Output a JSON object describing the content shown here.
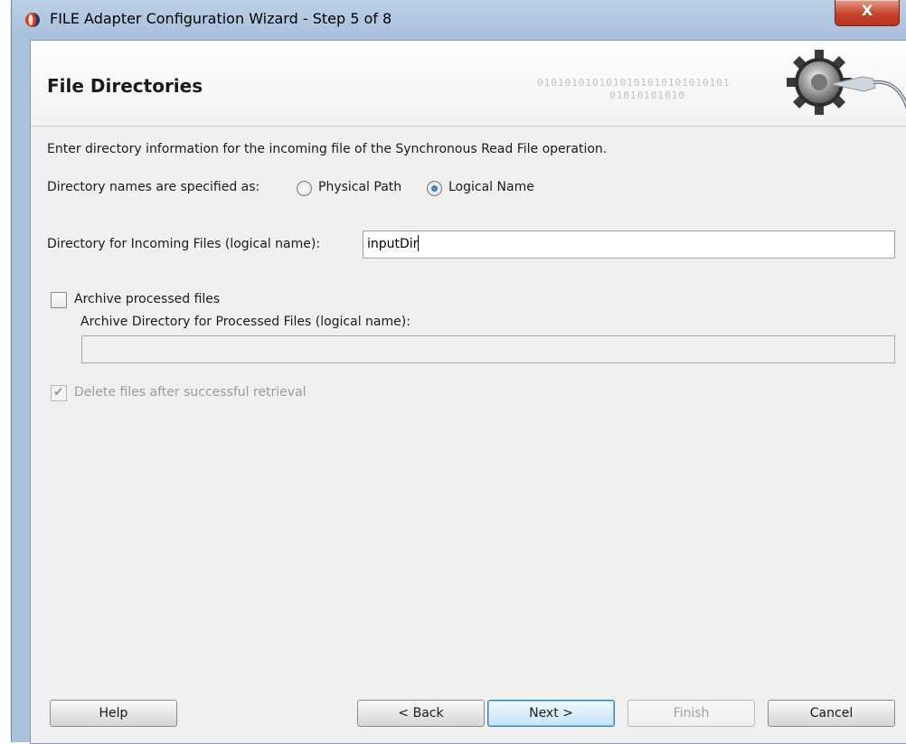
{
  "window": {
    "title": "FILE Adapter Configuration Wizard - Step 5 of 8",
    "close_glyph": "X"
  },
  "header": {
    "title": "File Directories",
    "watermark_line1": "0101010101010101010101010101",
    "watermark_line2": "01010101010"
  },
  "instructions": "Enter directory information for the incoming file of the Synchronous Read File operation.",
  "directory_names": {
    "label": "Directory names are specified as:",
    "options": [
      {
        "label": "Physical Path",
        "selected": false
      },
      {
        "label": "Logical Name",
        "selected": true
      }
    ]
  },
  "incoming_dir": {
    "label": "Directory for Incoming Files (logical name):",
    "value": "inputDir"
  },
  "archive": {
    "checkbox_label": "Archive processed files",
    "checked": false,
    "dir_label": "Archive Directory for Processed Files (logical name):",
    "dir_value": ""
  },
  "delete_after": {
    "label": "Delete files after successful retrieval",
    "checked": true,
    "enabled": false
  },
  "buttons": {
    "help": "Help",
    "back": "< Back",
    "next": "Next >",
    "finish": "Finish",
    "cancel": "Cancel"
  },
  "colors": {
    "accent_blue": "#3c7fb1",
    "close_red": "#c7432b",
    "disabled_text": "#9a9a9a"
  },
  "icons": [
    "oracle-app-icon",
    "close-icon",
    "gear-plug-icon",
    "radio-icon",
    "checkbox-icon"
  ]
}
